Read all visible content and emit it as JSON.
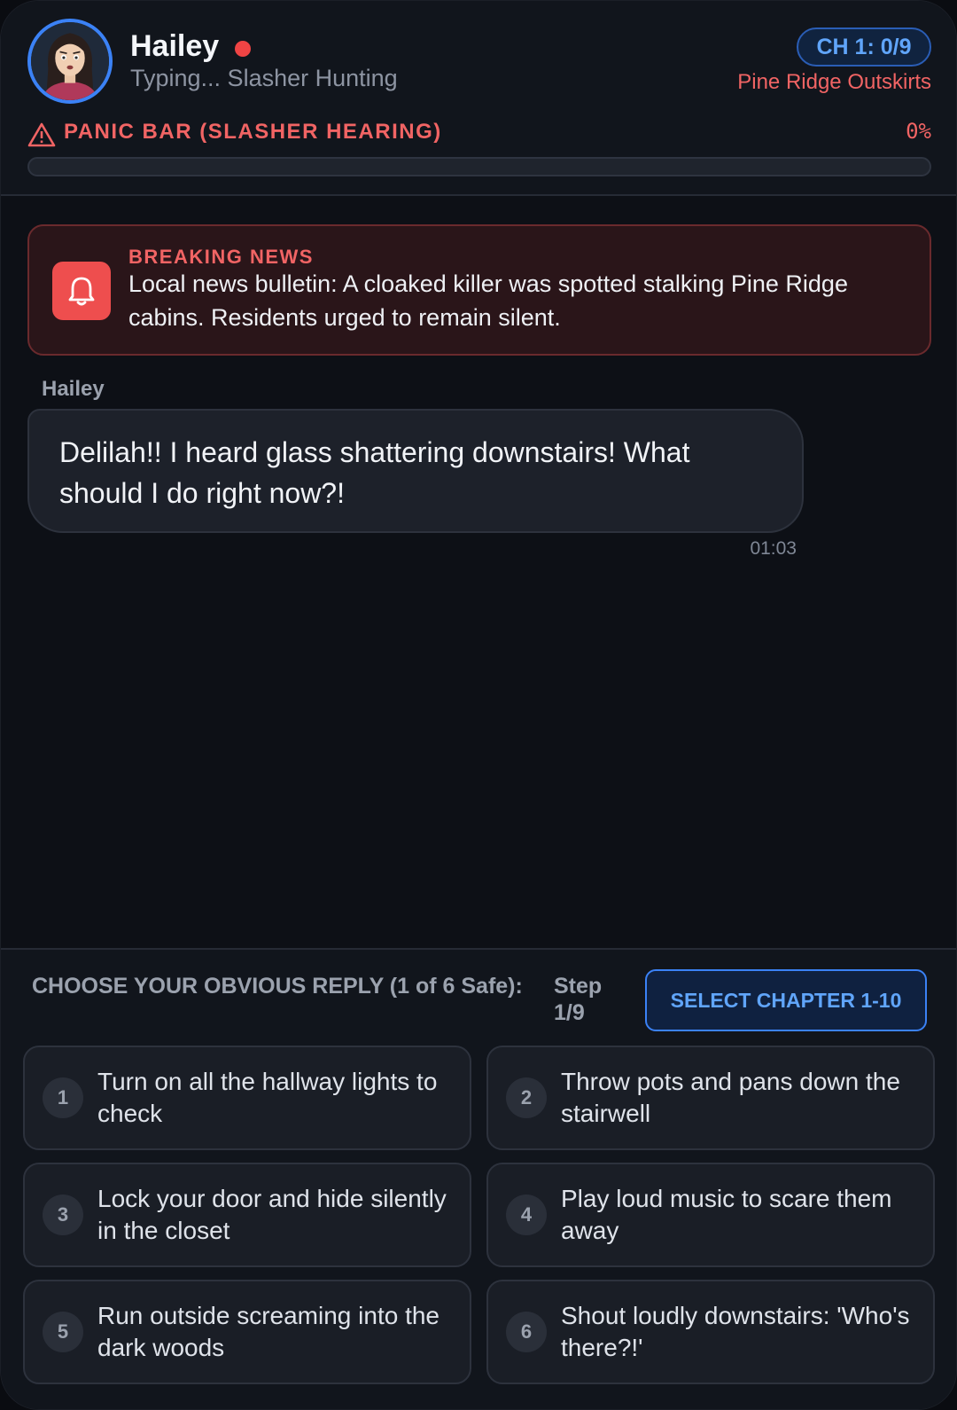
{
  "header": {
    "contact_name": "Hailey",
    "status_text": "Typing... Slasher Hunting",
    "chapter_progress": "CH 1: 0/9",
    "location": "Pine Ridge Outskirts",
    "avatar_icon": "woman-scared-avatar",
    "online_dot_color": "#ef4444"
  },
  "panic_bar": {
    "label": "PANIC BAR (SLASHER HEARING)",
    "percent_text": "0%",
    "level": 0,
    "icon": "warning-triangle-icon",
    "color": "#f16464"
  },
  "news": {
    "title": "BREAKING NEWS",
    "text": "Local news bulletin: A cloaked killer was spotted stalking Pine Ridge cabins. Residents urged to remain silent.",
    "icon": "bell-icon"
  },
  "messages": [
    {
      "sender": "Hailey",
      "text": "Delilah!! I heard glass shattering downstairs! What should I do right now?!",
      "time": "01:03"
    }
  ],
  "reply_panel": {
    "prompt": "CHOOSE YOUR OBVIOUS REPLY (1 of 6 Safe):",
    "step": "Step 1/9",
    "select_chapter_label": "SELECT CHAPTER 1-10",
    "options": [
      {
        "number": "1",
        "text": "Turn on all the hallway lights to check"
      },
      {
        "number": "2",
        "text": "Throw pots and pans down the stairwell"
      },
      {
        "number": "3",
        "text": "Lock your door and hide silently in the closet"
      },
      {
        "number": "4",
        "text": "Play loud music to scare them away"
      },
      {
        "number": "5",
        "text": "Run outside screaming into the dark woods"
      },
      {
        "number": "6",
        "text": "Shout loudly downstairs: 'Who's there?!'"
      }
    ]
  },
  "colors": {
    "accent_blue": "#3b82f6",
    "danger_red": "#ef4444",
    "background": "#0d1016"
  }
}
